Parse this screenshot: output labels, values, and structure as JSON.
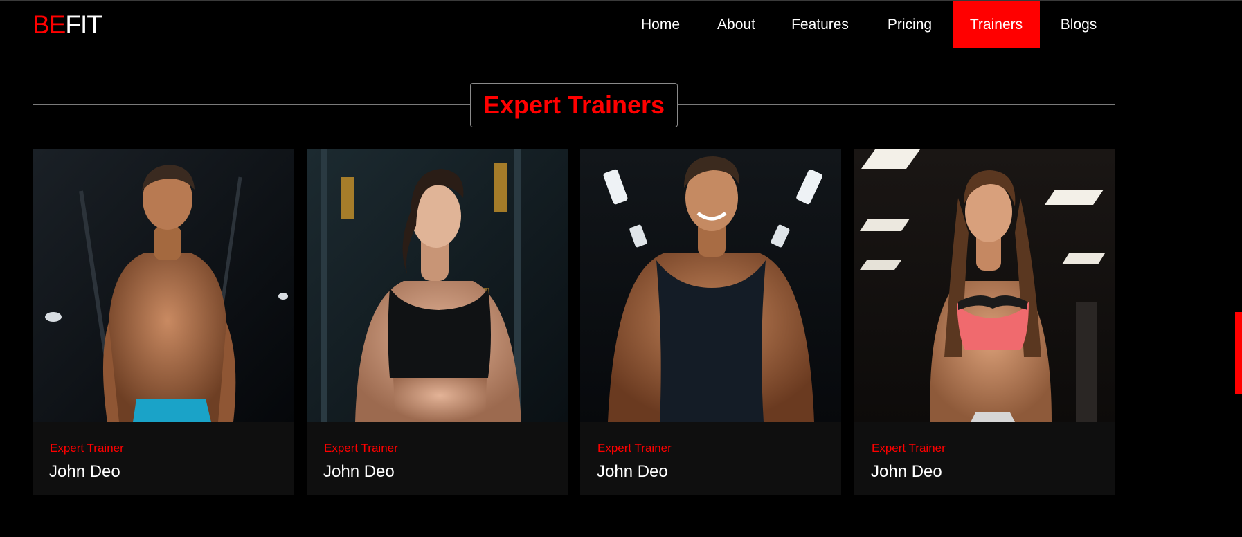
{
  "brand": {
    "part1": "BE",
    "part2": "FIT"
  },
  "nav": {
    "items": [
      {
        "label": "Home"
      },
      {
        "label": "About"
      },
      {
        "label": "Features"
      },
      {
        "label": "Pricing"
      },
      {
        "label": "Trainers",
        "active": true
      },
      {
        "label": "Blogs"
      }
    ]
  },
  "section": {
    "title": "Expert Trainers"
  },
  "trainers": [
    {
      "role": "Expert Trainer",
      "name": "John Deo"
    },
    {
      "role": "Expert Trainer",
      "name": "John Deo"
    },
    {
      "role": "Expert Trainer",
      "name": "John Deo"
    },
    {
      "role": "Expert Trainer",
      "name": "John Deo"
    }
  ],
  "colors": {
    "accent": "#ff0000",
    "background": "#000000",
    "card": "#0f0f0f"
  }
}
